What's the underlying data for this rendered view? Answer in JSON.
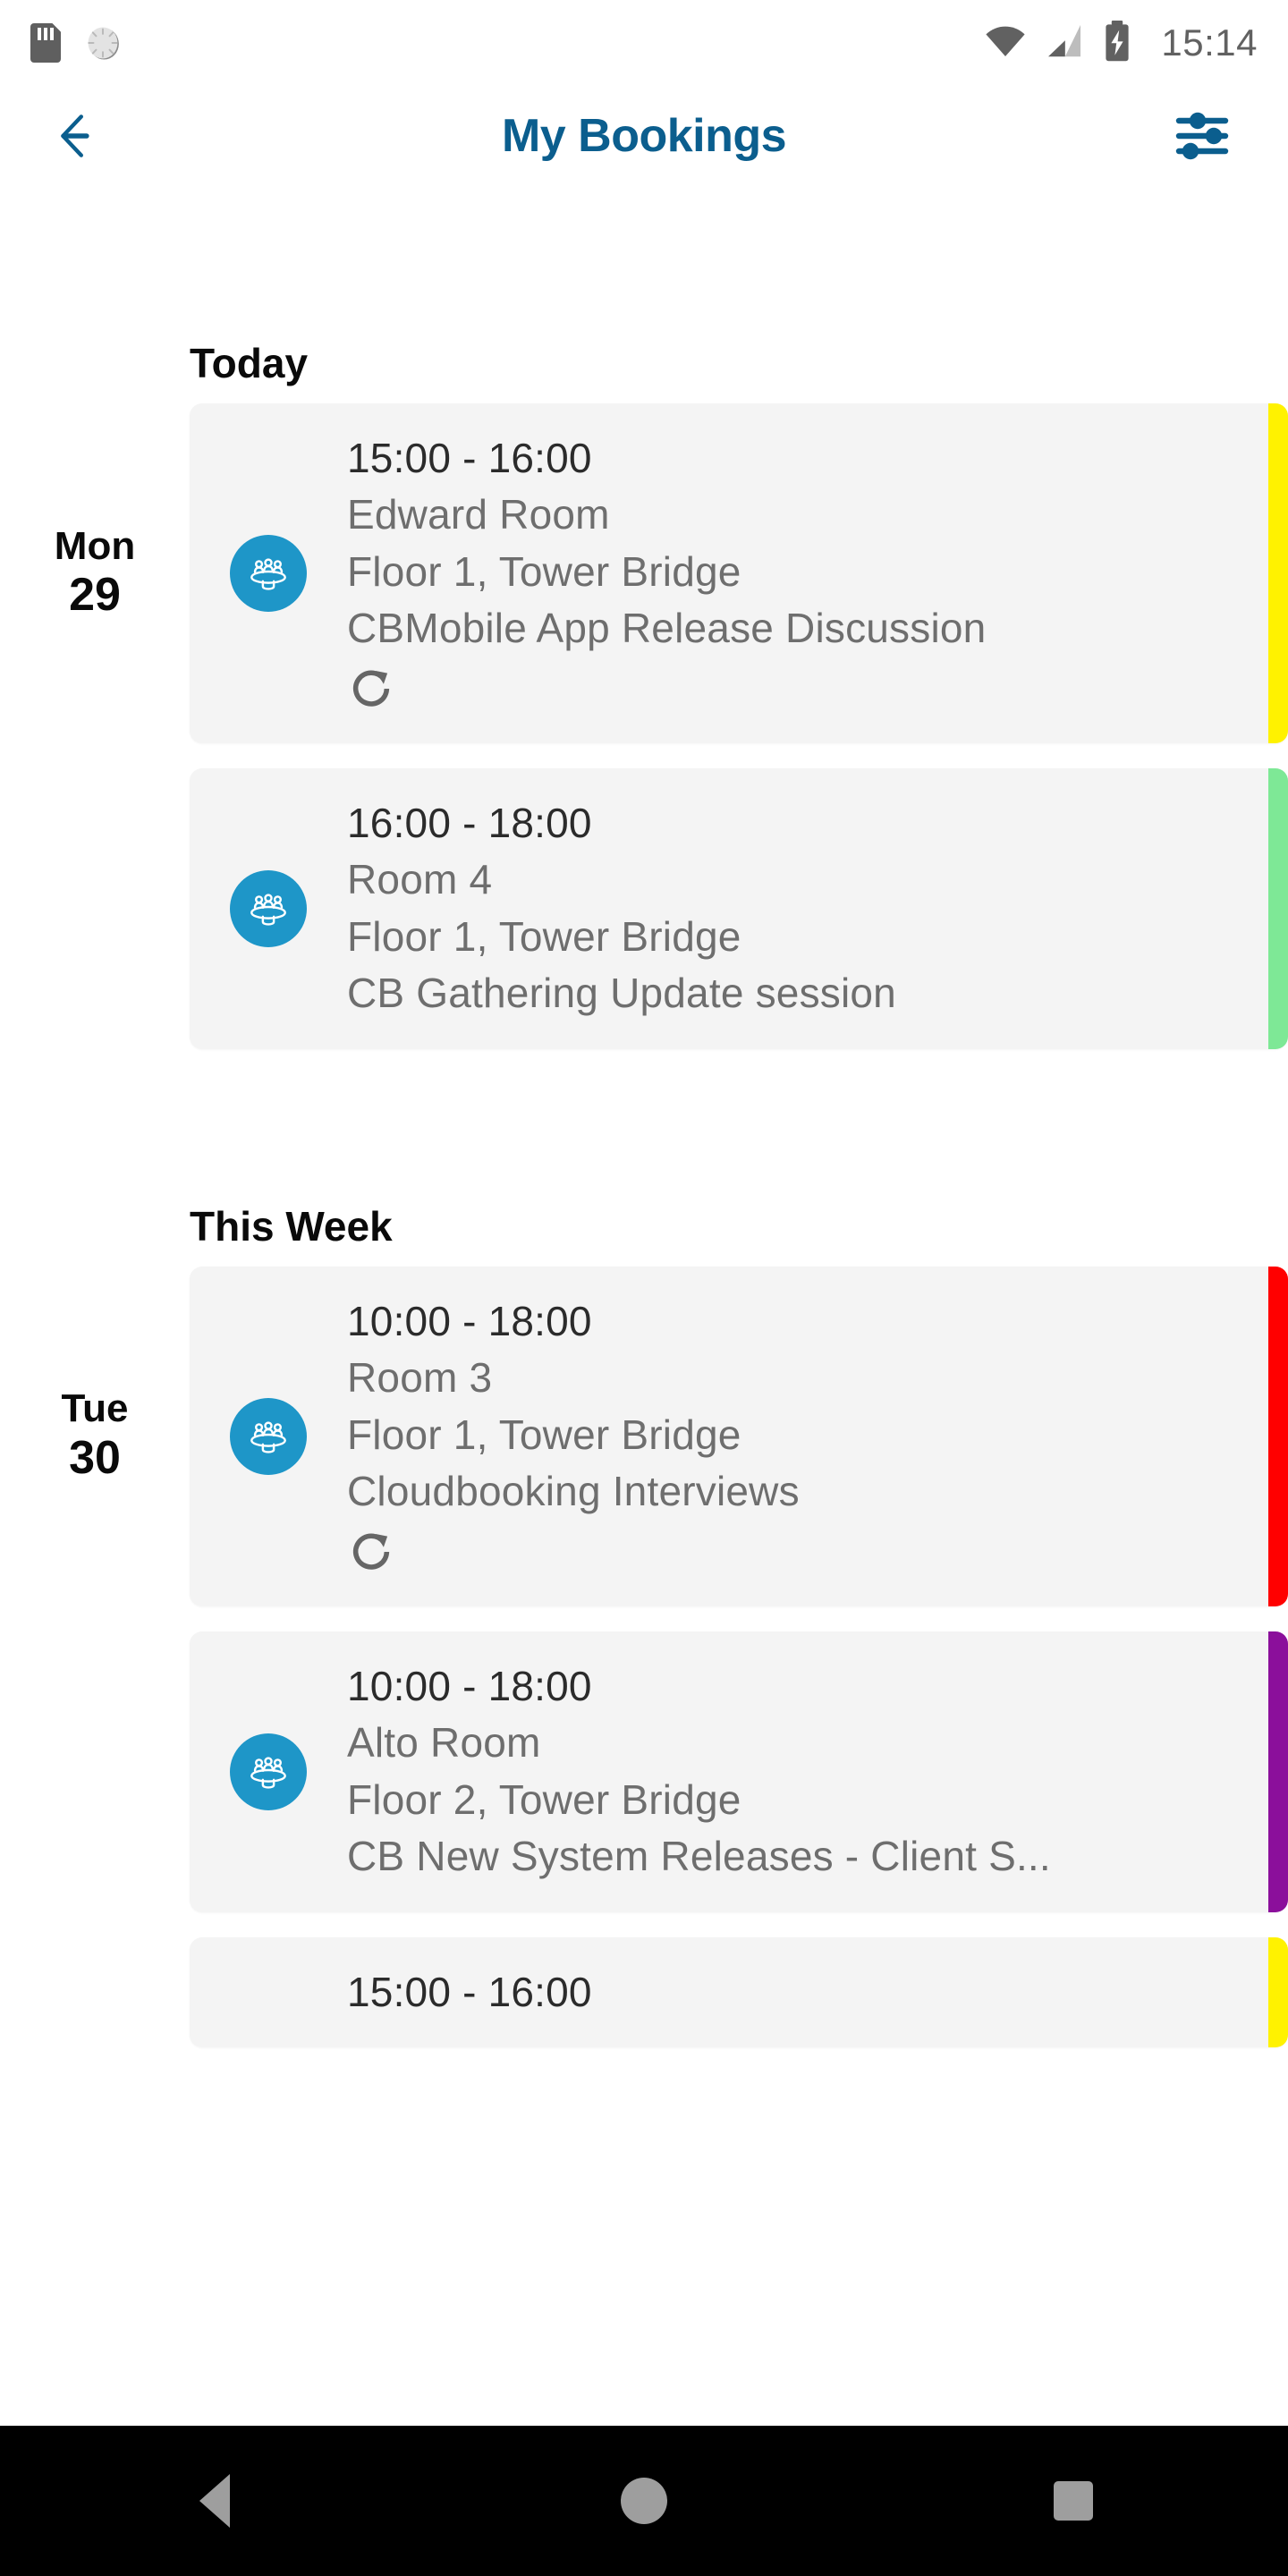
{
  "status_bar": {
    "time": "15:14",
    "icons": {
      "sd_card": "sd-card-icon",
      "spinner": "spinner-icon",
      "wifi": "wifi-icon",
      "signal": "cellular-signal-icon",
      "battery": "battery-charging-icon"
    }
  },
  "header": {
    "title": "My Bookings",
    "back_icon": "back-arrow-icon",
    "filter_icon": "filter-sliders-icon",
    "title_color": "#0b5e8e"
  },
  "sections": [
    {
      "title": "Today",
      "rows": [
        {
          "date_dow": "Mon",
          "date_num": "29",
          "show_date": true,
          "icon": "meeting-room-icon",
          "time": "15:00 - 16:00",
          "room": "Edward Room",
          "location": "Floor 1, Tower Bridge",
          "subject": "CBMobile App Release Discussion",
          "recurring": true,
          "status_color": "#fff200"
        },
        {
          "date_dow": "",
          "date_num": "",
          "show_date": false,
          "icon": "meeting-room-icon",
          "time": "16:00 - 18:00",
          "room": "Room 4",
          "location": "Floor 1, Tower Bridge",
          "subject": "CB Gathering Update session",
          "recurring": false,
          "status_color": "#7ee896"
        }
      ]
    },
    {
      "title": "This Week",
      "rows": [
        {
          "date_dow": "Tue",
          "date_num": "30",
          "show_date": true,
          "icon": "meeting-room-icon",
          "time": "10:00 - 18:00",
          "room": "Room 3",
          "location": "Floor 1, Tower Bridge",
          "subject": "Cloudbooking Interviews",
          "recurring": true,
          "status_color": "#ff0000"
        },
        {
          "date_dow": "",
          "date_num": "",
          "show_date": false,
          "icon": "meeting-room-icon",
          "time": "10:00 - 18:00",
          "room": "Alto Room",
          "location": "Floor 2, Tower Bridge",
          "subject": "CB New System Releases - Client S...",
          "recurring": false,
          "status_color": "#8b0f9b"
        },
        {
          "date_dow": "",
          "date_num": "",
          "show_date": false,
          "icon": "meeting-room-icon",
          "time": "15:00 - 16:00",
          "room": "",
          "location": "",
          "subject": "",
          "recurring": false,
          "partial": true,
          "status_color": "#fff200"
        }
      ]
    }
  ],
  "nav_bar": {
    "back_label": "back-nav-button",
    "home_label": "home-nav-button",
    "recents_label": "recents-nav-button"
  },
  "theme": {
    "card_bg": "#f4f4f4",
    "icon_blue": "#1e96c8",
    "text_primary": "#2b2b2b",
    "text_secondary": "#6e6e6e"
  }
}
